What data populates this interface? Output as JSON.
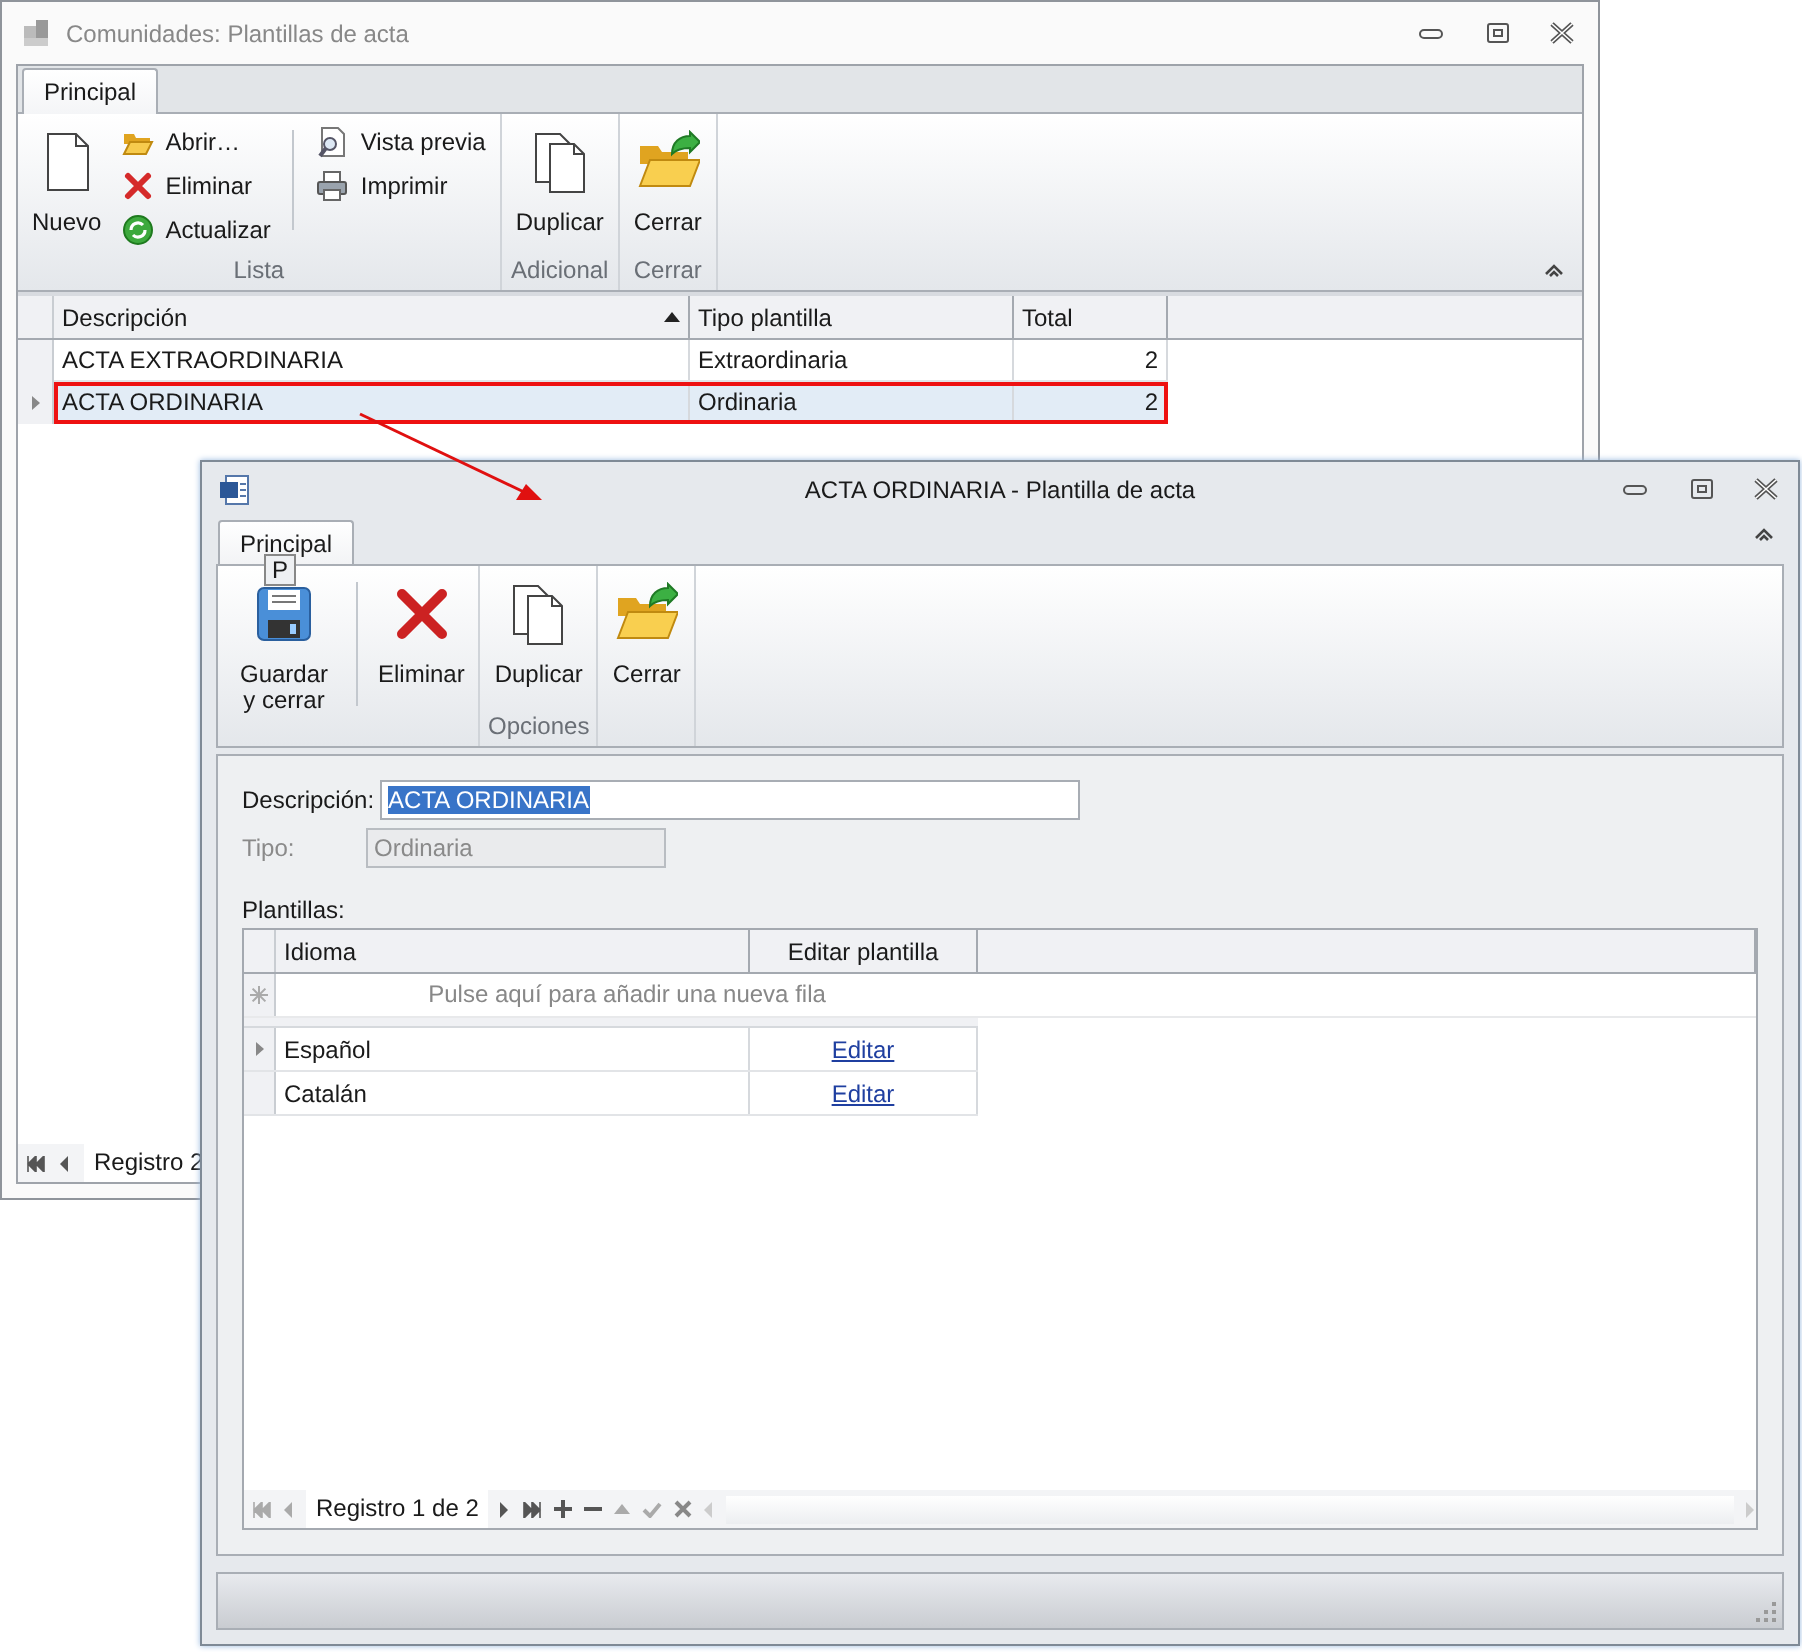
{
  "back_window": {
    "title": "Comunidades: Plantillas de acta",
    "tabs": [
      {
        "label": "Principal",
        "selected": true
      }
    ],
    "ribbon_groups": [
      {
        "label": "Lista",
        "items": [
          {
            "kind": "large",
            "label": "Nuevo"
          },
          {
            "kind": "stack",
            "items": [
              "Abrir…",
              "Eliminar",
              "Actualizar"
            ]
          },
          {
            "kind": "separator"
          },
          {
            "kind": "stack",
            "items": [
              "Vista previa",
              "Imprimir"
            ]
          }
        ]
      },
      {
        "label": "Adicional",
        "items": [
          {
            "kind": "large",
            "label": "Duplicar"
          }
        ]
      },
      {
        "label": "Cerrar",
        "items": [
          {
            "kind": "large",
            "label": "Cerrar"
          }
        ]
      }
    ],
    "grid": {
      "columns": [
        {
          "label": "Descripción",
          "sorted": true
        },
        {
          "label": "Tipo plantilla",
          "sorted": false
        },
        {
          "label": "Total",
          "sorted": false
        }
      ],
      "rows": [
        {
          "selected": false,
          "cells": [
            "ACTA EXTRAORDINARIA",
            "Extraordinaria",
            "2"
          ]
        },
        {
          "selected": true,
          "cells": [
            "ACTA ORDINARIA",
            "Ordinaria",
            "2"
          ]
        }
      ]
    },
    "navigator": "Registro 2"
  },
  "front_window": {
    "title": "ACTA ORDINARIA - Plantilla de acta",
    "tabs": [
      {
        "label": "Principal",
        "selected": true,
        "keytip": "P"
      }
    ],
    "ribbon_groups": [
      {
        "items": [
          {
            "kind": "large",
            "label": "Guardar y cerrar"
          },
          {
            "kind": "separator"
          },
          {
            "kind": "large",
            "label": "Eliminar"
          }
        ]
      },
      {
        "label": "Opciones",
        "items": [
          {
            "kind": "large",
            "label": "Duplicar"
          }
        ]
      },
      {
        "items": [
          {
            "kind": "large",
            "label": "Cerrar"
          }
        ]
      }
    ],
    "form": {
      "description": {
        "label": "Descripción:",
        "value": "ACTA ORDINARIA",
        "selected": true
      },
      "type": {
        "label": "Tipo:",
        "value": "Ordinaria",
        "disabled": true
      },
      "templates_label": "Plantillas:"
    },
    "templates_grid": {
      "columns": [
        "Idioma",
        "Editar plantilla"
      ],
      "new_row_prompt": "Pulse aquí para añadir una nueva fila",
      "rows": [
        {
          "selected": true,
          "language": "Español",
          "link": "Editar"
        },
        {
          "selected": false,
          "language": "Catalán",
          "link": "Editar"
        }
      ],
      "navigator": "Registro 1 de 2"
    }
  }
}
